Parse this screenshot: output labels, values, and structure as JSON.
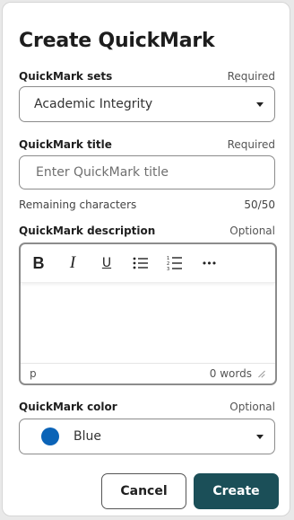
{
  "dialog": {
    "title": "Create QuickMark"
  },
  "sets": {
    "label": "QuickMark sets",
    "requirement": "Required",
    "value": "Academic Integrity"
  },
  "title_field": {
    "label": "QuickMark title",
    "requirement": "Required",
    "placeholder": "Enter QuickMark title",
    "remaining_label": "Remaining characters",
    "remaining_count": "50/50"
  },
  "description": {
    "label": "QuickMark description",
    "requirement": "Optional",
    "toolbar": {
      "bold": "B",
      "italic": "I",
      "underline": "U",
      "more": "•••"
    },
    "path": "p",
    "word_count": "0 words"
  },
  "color": {
    "label": "QuickMark color",
    "requirement": "Optional",
    "value": "Blue",
    "swatch": "#0a63b7"
  },
  "actions": {
    "cancel": "Cancel",
    "create": "Create"
  }
}
